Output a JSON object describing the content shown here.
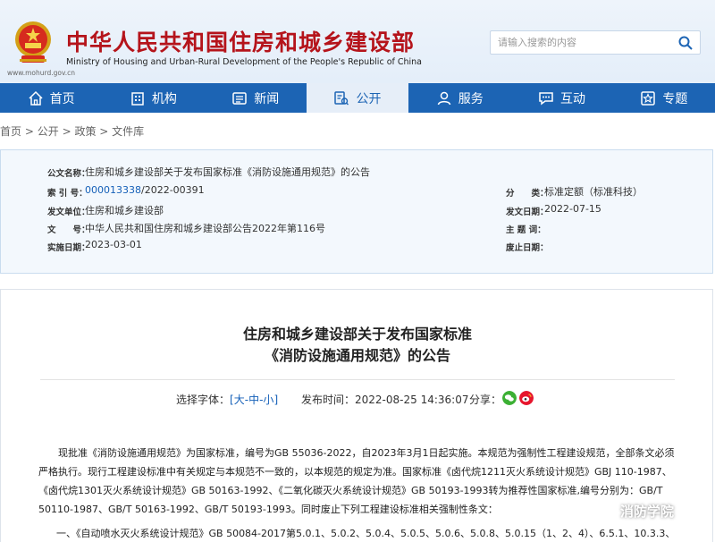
{
  "header": {
    "site_name": "中华人民共和国住房和城乡建设部",
    "site_name_en": "Ministry of Housing and Urban-Rural Development of the People's Republic of China",
    "site_url": "www.mohurd.gov.cn",
    "search_placeholder": "请输入搜索的内容"
  },
  "nav": {
    "items": [
      {
        "label": "首页",
        "icon": "home-icon"
      },
      {
        "label": "机构",
        "icon": "building-icon"
      },
      {
        "label": "新闻",
        "icon": "news-icon"
      },
      {
        "label": "公开",
        "icon": "disclosure-icon",
        "active": true
      },
      {
        "label": "服务",
        "icon": "service-icon"
      },
      {
        "label": "互动",
        "icon": "chat-icon"
      },
      {
        "label": "专题",
        "icon": "topic-icon"
      }
    ]
  },
  "breadcrumb": [
    "首页",
    "公开",
    "政策",
    "文件库"
  ],
  "info": {
    "title_label": "公文名称：",
    "title_value": "住房和城乡建设部关于发布国家标准《消防设施通用规范》的公告",
    "index_label": "索 引 号：",
    "index_code": "000013338",
    "index_suffix": "/2022-00391",
    "category_label": "分　　类：",
    "category_value": "标准定额（标准科技）",
    "issuer_label": "发文单位：",
    "issuer_value": "住房和城乡建设部",
    "issue_date_label": "发文日期：",
    "issue_date_value": "2022-07-15",
    "doc_no_label": "文　　号：",
    "doc_no_value": "中华人民共和国住房和城乡建设部公告2022年第116号",
    "keywords_label": "主 题 词：",
    "effective_label": "实施日期：",
    "effective_value": "2023-03-01",
    "repeal_label": "废止日期："
  },
  "article": {
    "title_line1": "住房和城乡建设部关于发布国家标准",
    "title_line2": "《消防设施通用规范》的公告",
    "font_label": "选择字体：",
    "font_open": "[",
    "font_large": "大",
    "font_sep1": "-",
    "font_medium": "中",
    "font_sep2": "-",
    "font_small": "小",
    "font_close": "]",
    "publish_label": "发布时间：",
    "publish_time": "2022-08-25 14:36:07",
    "share_label": "分享：",
    "paragraph1": "现批准《消防设施通用规范》为国家标准，编号为GB 55036-2022，自2023年3月1日起实施。本规范为强制性工程建设规范，全部条文必须严格执行。现行工程建设标准中有关规定与本规范不一致的，以本规范的规定为准。国家标准《卤代烷1211灭火系统设计规范》GBJ 110-1987、《卤代烷1301灭火系统设计规范》GB 50163-1992、《二氧化碳灭火系统设计规范》GB 50193-1993转为推荐性国家标准,编号分别为：GB/T 50110-1987、GB/T 50163-1992、GB/T 50193-1993。同时废止下列工程建设标准相关强制性条文：",
    "paragraph2": "一、《自动喷水灭火系统设计规范》GB 50084-2017第5.0.1、5.0.2、5.0.4、5.0.5、5.0.6、5.0.8、5.0.15（1、2、4）、6.5.1、10.3.3、"
  },
  "watermark": {
    "text": "消防学院"
  },
  "colors": {
    "nav_bg": "#1c64b4",
    "title_red": "#b5141b",
    "link_blue": "#1560b8"
  }
}
